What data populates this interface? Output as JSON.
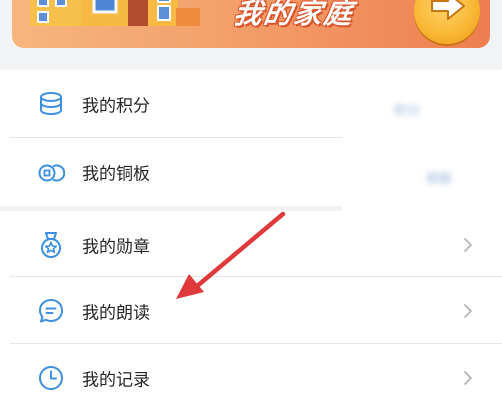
{
  "banner": {
    "title": "我的家庭",
    "icons": {
      "house": "house-illustration",
      "arrow": "arrow-right-icon"
    }
  },
  "group_1": {
    "items": [
      {
        "label": "我的积分",
        "icon": "coin-stack-icon",
        "value": "积分"
      },
      {
        "label": "我的铜板",
        "icon": "copper-coins-icon",
        "value": "铜板"
      }
    ]
  },
  "group_2": {
    "items": [
      {
        "label": "我的勋章",
        "icon": "medal-icon"
      },
      {
        "label": "我的朗读",
        "icon": "speech-bubble-icon"
      },
      {
        "label": "我的记录",
        "icon": "clock-icon"
      }
    ]
  },
  "colors": {
    "accent_icon": "#3d8fe0",
    "annotation_arrow": "#e0393b",
    "banner_start": "#f7b57e",
    "banner_end": "#ee7e4f"
  }
}
